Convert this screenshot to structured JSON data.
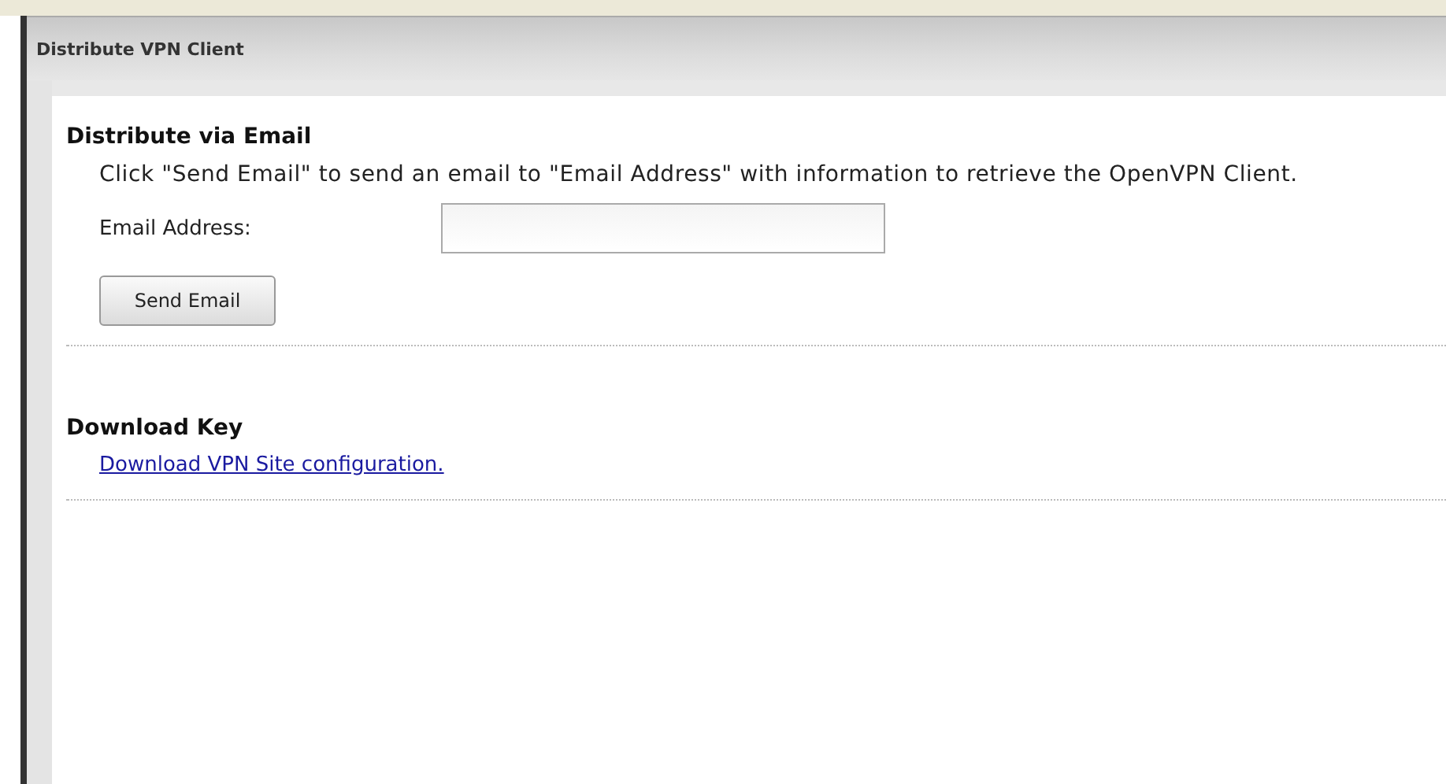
{
  "window": {
    "title": "Distribute VPN Client"
  },
  "sections": [
    {
      "kind": "email",
      "heading": "Distribute via Email",
      "description": "Click \"Send Email\" to send an email to \"Email Address\" with information to retrieve the OpenVPN Client.",
      "field_label": "Email Address:",
      "button": "Send Email"
    },
    {
      "kind": "download",
      "heading": "Download Key",
      "link": "Download VPN Site configuration."
    }
  ]
}
